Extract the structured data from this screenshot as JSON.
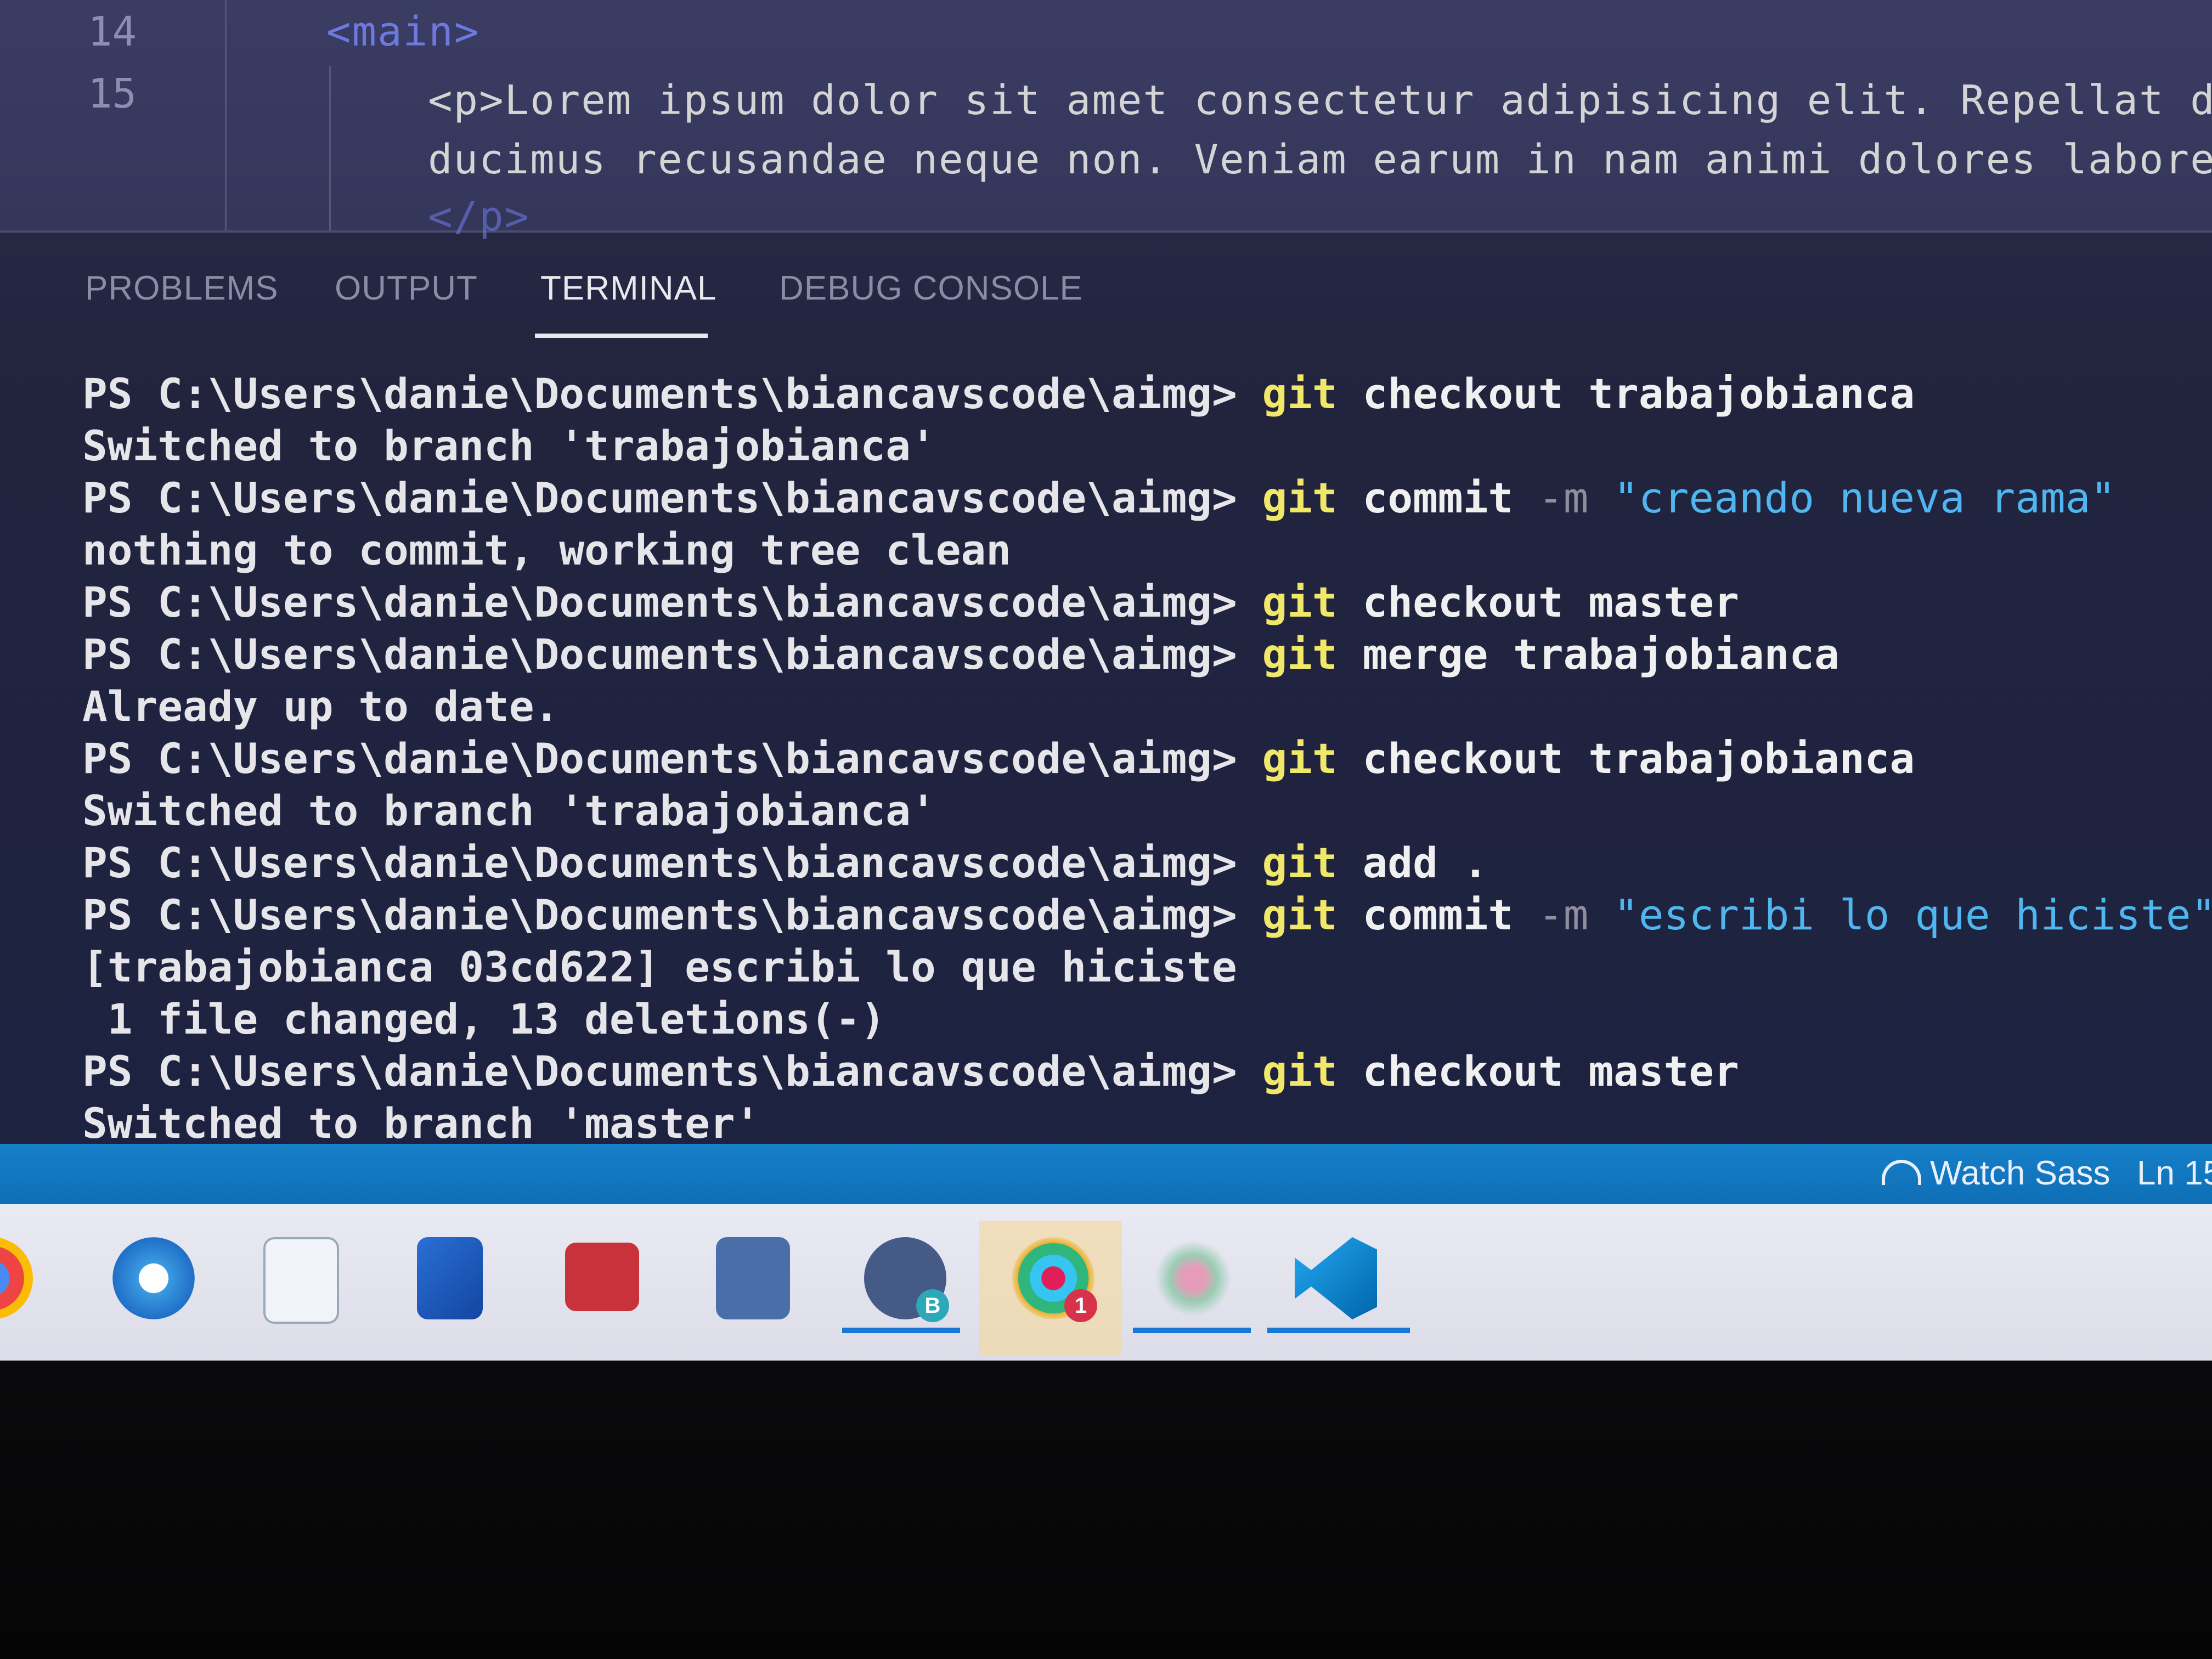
{
  "editor": {
    "line_numbers": [
      "14",
      "15"
    ],
    "line14_code": "<main>",
    "line15_code": "<p>Lorem ipsum dolor sit amet consectetur adipisicing elit. Repellat dolor de",
    "line15b_code": "ducimus recusandae neque non. Veniam earum in nam animi dolores labore tempor",
    "line15c_code": "</p>"
  },
  "panel": {
    "tabs": [
      "PROBLEMS",
      "OUTPUT",
      "TERMINAL",
      "DEBUG CONSOLE"
    ],
    "active_tab": "TERMINAL"
  },
  "terminal": {
    "prompt": "PS C:\\Users\\danie\\Documents\\biancavscode\\aimg> ",
    "lines": [
      {
        "type": "cmd",
        "git": "git",
        "rest": " checkout trabajobianca",
        "flag": "",
        "str": ""
      },
      {
        "type": "out",
        "text": "Switched to branch 'trabajobianca'"
      },
      {
        "type": "cmd",
        "git": "git",
        "rest": " commit ",
        "flag": "-m",
        "str": " \"creando nueva rama\""
      },
      {
        "type": "out",
        "text": "nothing to commit, working tree clean"
      },
      {
        "type": "cmd",
        "git": "git",
        "rest": " checkout master",
        "flag": "",
        "str": ""
      },
      {
        "type": "cmd",
        "git": "git",
        "rest": " merge trabajobianca",
        "flag": "",
        "str": ""
      },
      {
        "type": "out",
        "text": "Already up to date."
      },
      {
        "type": "cmd",
        "git": "git",
        "rest": " checkout trabajobianca",
        "flag": "",
        "str": ""
      },
      {
        "type": "out",
        "text": "Switched to branch 'trabajobianca'"
      },
      {
        "type": "cmd",
        "git": "git",
        "rest": " add .",
        "flag": "",
        "str": ""
      },
      {
        "type": "cmd",
        "git": "git",
        "rest": " commit ",
        "flag": "-m",
        "str": " \"escribi lo que hiciste\""
      },
      {
        "type": "out",
        "text": "[trabajobianca 03cd622] escribi lo que hiciste"
      },
      {
        "type": "out",
        "text": " 1 file changed, 13 deletions(-)"
      },
      {
        "type": "cmd",
        "git": "git",
        "rest": " checkout master",
        "flag": "",
        "str": ""
      },
      {
        "type": "out",
        "text": "Switched to branch 'master'"
      }
    ]
  },
  "statusbar": {
    "watch_sass": "Watch Sass",
    "line_col": "Ln 15"
  },
  "taskbar": {
    "icons": [
      "chrome-icon",
      "edge-icon",
      "notepad-icon",
      "remote-desktop-icon",
      "kaspersky-icon",
      "stackoverflow-icon",
      "zoom-icon",
      "slack-icon",
      "git-icon",
      "vscode-icon"
    ],
    "zoom_badge": "B",
    "slack_badge": "1",
    "colors": {
      "accent": "#1a78d4",
      "status_bar": "#1680c8"
    }
  }
}
